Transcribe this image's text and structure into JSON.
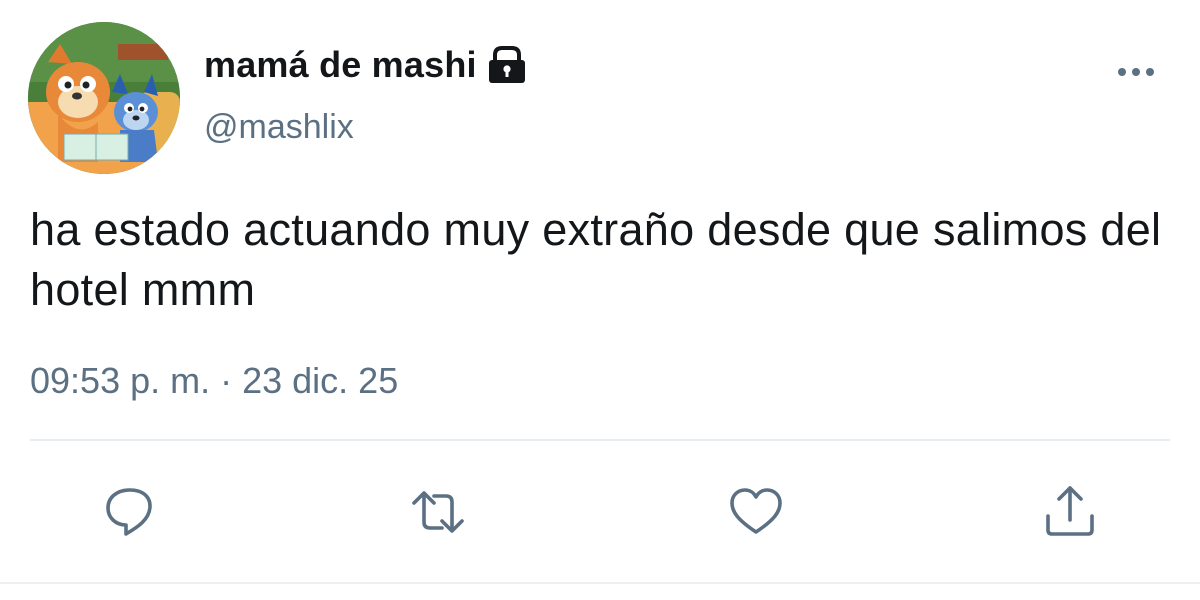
{
  "tweet": {
    "display_name": "mamá de mashi",
    "handle": "@mashlix",
    "protected": true,
    "text": "ha estado actuando muy extraño desde que salimos del hotel mmm",
    "timestamp": "09:53 p. m. · 23 dic. 25"
  },
  "icons": {
    "avatar": "avatar-cartoon-dogs-icon",
    "lock": "lock-icon",
    "more": "more-options-icon",
    "reply": "reply-icon",
    "retweet": "retweet-icon",
    "like": "heart-icon",
    "share": "share-icon"
  },
  "colors": {
    "text": "#14171a",
    "secondary": "#5b7083",
    "icon": "#1da1f2",
    "divider": "#e6ecf0"
  }
}
